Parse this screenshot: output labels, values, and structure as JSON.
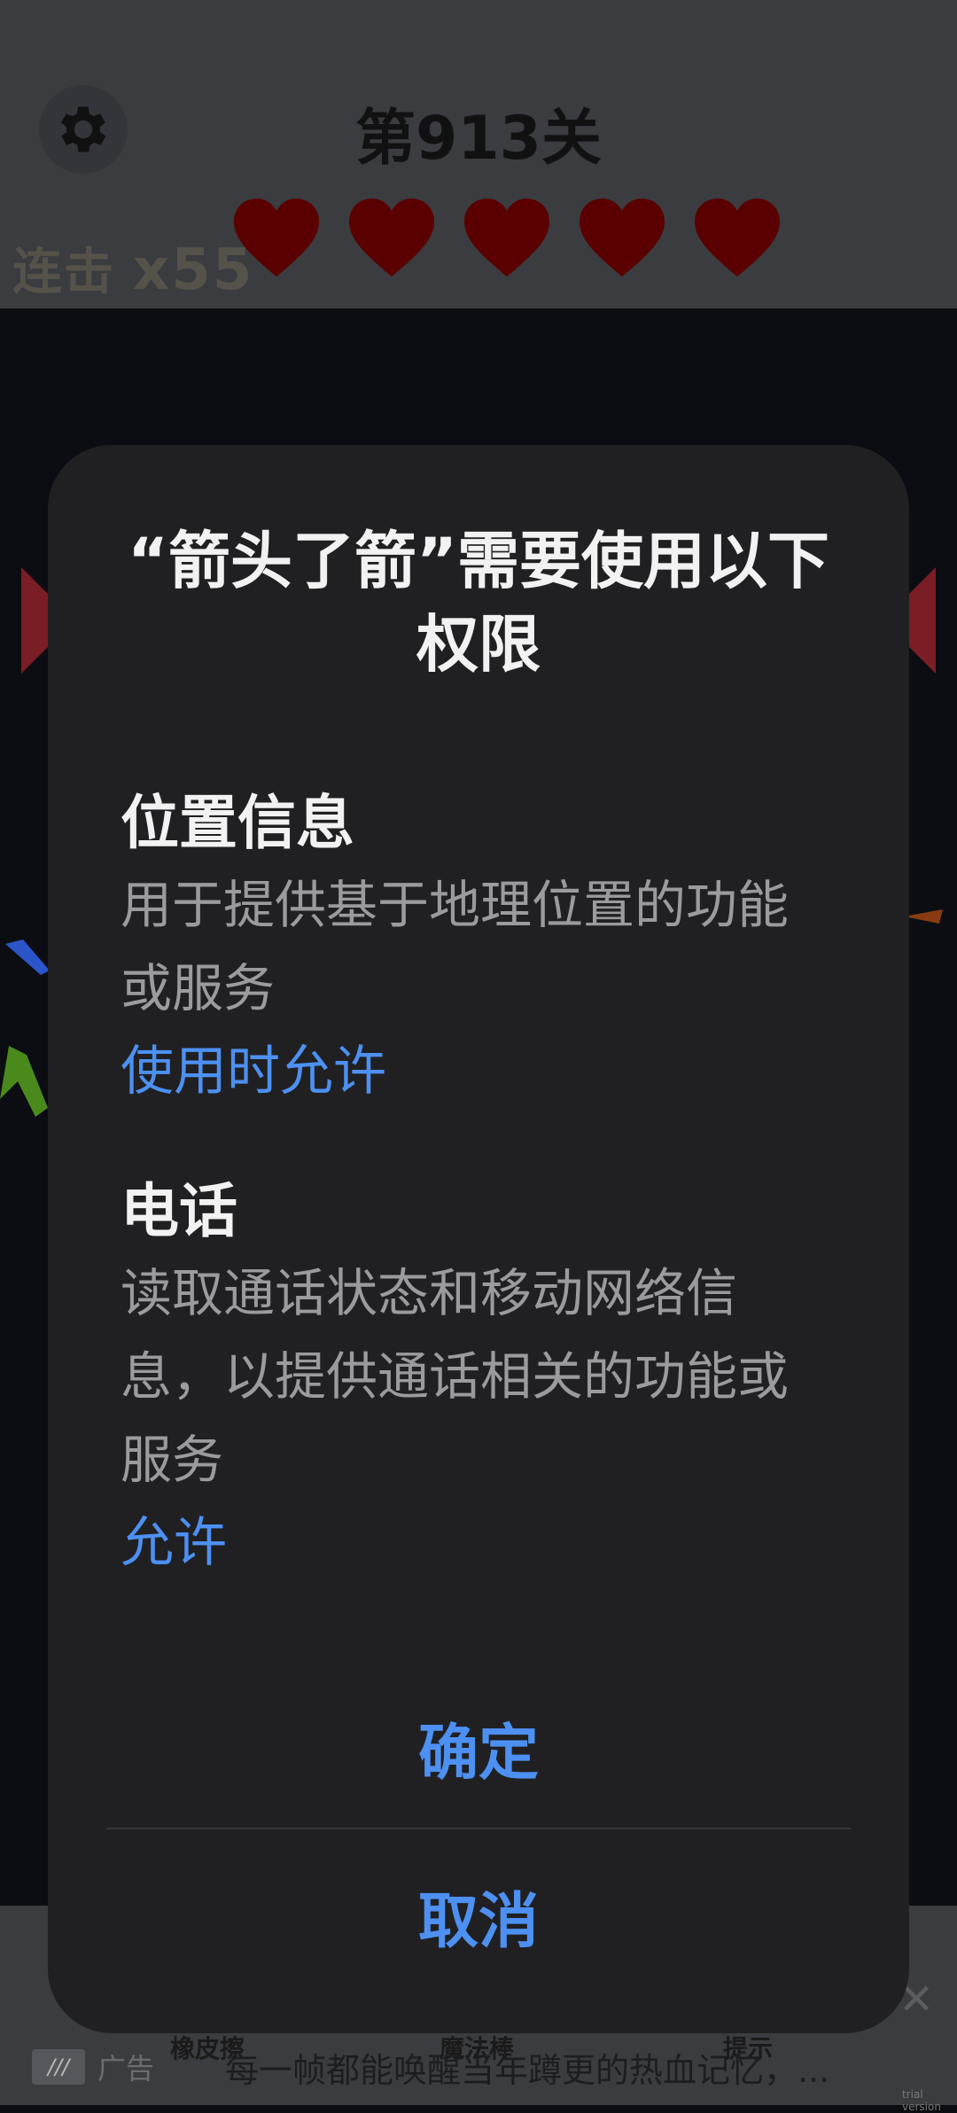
{
  "game": {
    "level_title": "第913关",
    "combo_label": "连击",
    "combo_multiplier": "x55",
    "hearts_count": 5,
    "tools": [
      "橡皮擦",
      "魔法棒",
      "提示"
    ],
    "ad": {
      "label": "广告",
      "text": "每一帧都能唤醒当年蹲更的热血记忆，...",
      "watermark": "trial version"
    }
  },
  "dialog": {
    "title": "“箭头了箭”需要使用以下权限",
    "permissions": [
      {
        "name": "位置信息",
        "description": "用于提供基于地理位置的功能或服务",
        "action": "使用时允许"
      },
      {
        "name": "电话",
        "description": "读取通话状态和移动网络信息，以提供通话相关的功能或服务",
        "action": "允许"
      }
    ],
    "confirm_label": "确定",
    "cancel_label": "取消"
  },
  "colors": {
    "dialog_bg": "#202022",
    "accent": "#4d90f2",
    "heart": "#5a0000"
  }
}
